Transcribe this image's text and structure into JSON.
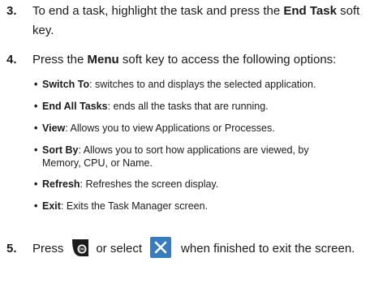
{
  "step3": {
    "number": "3.",
    "text_a": "To end a task, highlight the task and press the ",
    "bold": "End Task",
    "text_b": " soft key."
  },
  "step4": {
    "number": "4.",
    "text_a": "Press the ",
    "bold": "Menu",
    "text_b": " soft key to access the following options:"
  },
  "options": [
    {
      "term": "Switch To",
      "desc": ": switches to and displays the selected application."
    },
    {
      "term": "End All Tasks",
      "desc": ": ends all the tasks that are running."
    },
    {
      "term": "View",
      "desc": ": Allows you to view Applications or Processes."
    },
    {
      "term": "Sort By",
      "desc": ": Allows you to sort how applications are viewed, by Memory, CPU, or Name."
    },
    {
      "term": "Refresh",
      "desc": ": Refreshes the screen display."
    },
    {
      "term": "Exit",
      "desc": ": Exits the Task Manager screen."
    }
  ],
  "step5": {
    "number": "5.",
    "text_a": "Press",
    "text_b": "or select",
    "text_c": "when finished to exit the screen."
  },
  "bullet": "•",
  "icons": {
    "ok_key": "ok-key-icon",
    "close": "close-x-icon",
    "close_color": "#3a7bbf"
  }
}
